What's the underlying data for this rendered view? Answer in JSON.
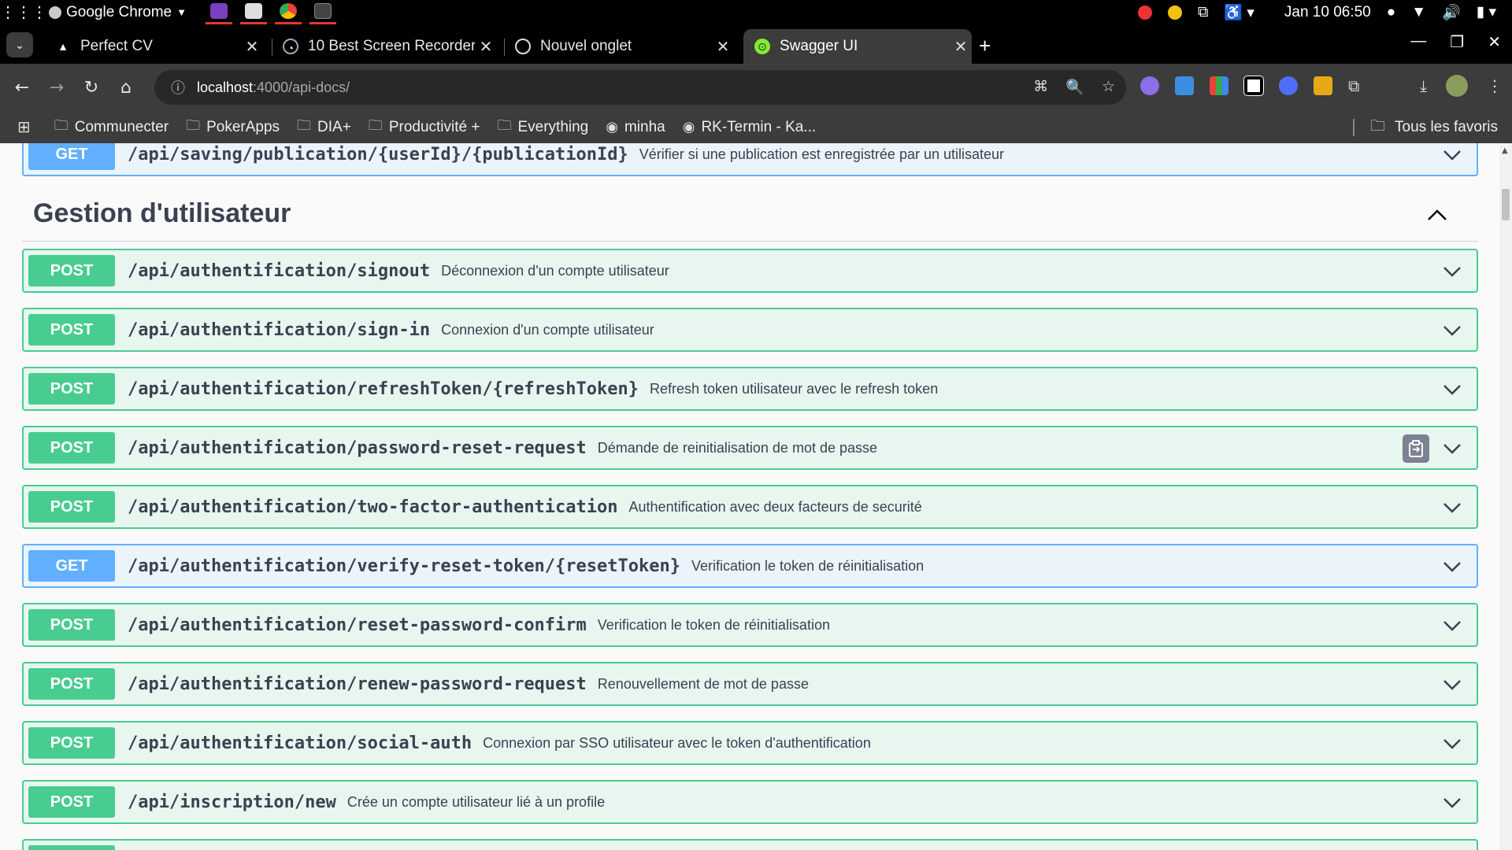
{
  "os": {
    "active_app": "Google Chrome",
    "datetime": "Jan 10  06:50"
  },
  "tabs": [
    {
      "title": "Perfect CV",
      "active": false
    },
    {
      "title": "10 Best Screen Recorder",
      "active": false
    },
    {
      "title": "Nouvel onglet",
      "active": false
    },
    {
      "title": "Swagger UI",
      "active": true
    }
  ],
  "address": {
    "host": "localhost",
    "rest": ":4000/api-docs/"
  },
  "bookmarks": [
    {
      "label": "Communecter",
      "icon": "folder-icon"
    },
    {
      "label": "PokerApps",
      "icon": "folder-icon"
    },
    {
      "label": "DIA+",
      "icon": "folder-icon"
    },
    {
      "label": "Productivité +",
      "icon": "folder-icon"
    },
    {
      "label": "Everything",
      "icon": "folder-icon"
    },
    {
      "label": "minha",
      "icon": "globe-icon"
    },
    {
      "label": "RK-Termin - Ka...",
      "icon": "globe-icon"
    }
  ],
  "bookmarks_all": "Tous les favoris",
  "swagger": {
    "top_partial": {
      "method": "GET",
      "path": "/api/saving/publication/{userId}/{publicationId}",
      "summary": "Vérifier si une publication est enregistrée par un utilisateur"
    },
    "section_title": "Gestion d'utilisateur",
    "operations": [
      {
        "method": "POST",
        "path": "/api/authentification/signout",
        "summary": "Déconnexion d'un compte utilisateur"
      },
      {
        "method": "POST",
        "path": "/api/authentification/sign-in",
        "summary": "Connexion d'un compte utilisateur"
      },
      {
        "method": "POST",
        "path": "/api/authentification/refreshToken/{refreshToken}",
        "summary": "Refresh token utilisateur avec le refresh token"
      },
      {
        "method": "POST",
        "path": "/api/authentification/password-reset-request",
        "summary": "Démande de reinitialisation de mot de passe"
      },
      {
        "method": "POST",
        "path": "/api/authentification/two-factor-authentication",
        "summary": "Authentification avec deux facteurs de securité"
      },
      {
        "method": "GET",
        "path": "/api/authentification/verify-reset-token/{resetToken}",
        "summary": "Verification le token de réinitialisation"
      },
      {
        "method": "POST",
        "path": "/api/authentification/reset-password-confirm",
        "summary": "Verification le token de réinitialisation"
      },
      {
        "method": "POST",
        "path": "/api/authentification/renew-password-request",
        "summary": "Renouvellement de mot de passe"
      },
      {
        "method": "POST",
        "path": "/api/authentification/social-auth",
        "summary": "Connexion par SSO utilisateur avec le token d'authentification"
      },
      {
        "method": "POST",
        "path": "/api/inscription/new",
        "summary": "Crée un compte utilisateur lié à un profile"
      },
      {
        "method": "POST",
        "path": "",
        "summary": ""
      }
    ]
  },
  "colors": {
    "post": "#49cc90",
    "get": "#61affe",
    "text": "#3b4151"
  }
}
